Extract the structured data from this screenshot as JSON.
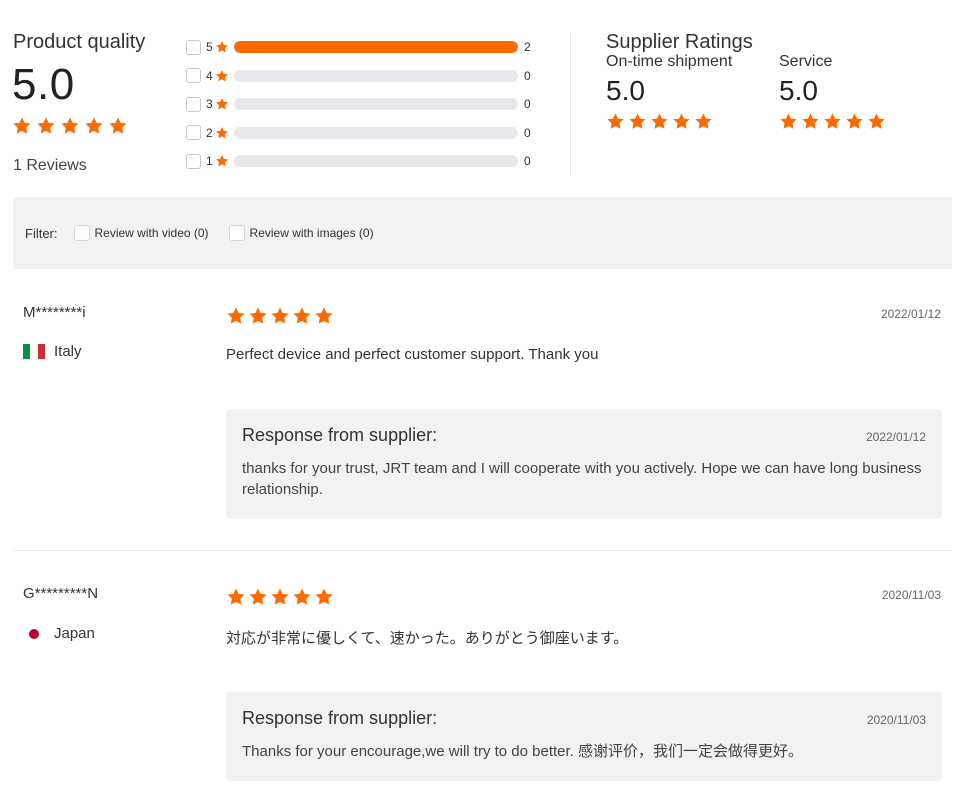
{
  "colors": {
    "accent": "#ff6a00",
    "bar_empty": "#e8e8ec",
    "panel_bg": "#f2f2f2"
  },
  "product_quality": {
    "title": "Product quality",
    "score": "5.0",
    "stars": 5,
    "reviews_label": "1 Reviews"
  },
  "distribution": [
    {
      "stars": "5",
      "count": "2",
      "fill": 1.0
    },
    {
      "stars": "4",
      "count": "0",
      "fill": 0
    },
    {
      "stars": "3",
      "count": "0",
      "fill": 0
    },
    {
      "stars": "2",
      "count": "0",
      "fill": 0
    },
    {
      "stars": "1",
      "count": "0",
      "fill": 0
    }
  ],
  "supplier_ratings": {
    "title": "Supplier Ratings",
    "on_time": {
      "label": "On-time shipment",
      "score": "5.0",
      "stars": 5
    },
    "service": {
      "label": "Service",
      "score": "5.0",
      "stars": 5
    }
  },
  "filter": {
    "label": "Filter:",
    "video": "Review with video (0)",
    "images": "Review with images (0)"
  },
  "reviews": [
    {
      "user": "M********i",
      "country": "Italy",
      "flag_icon": "italy-flag-icon",
      "stars": 5,
      "date": "2022/01/12",
      "text": "Perfect device and perfect customer support. Thank you",
      "response": {
        "title": "Response from supplier:",
        "date": "2022/01/12",
        "text": "thanks for your trust, JRT team and I will cooperate with you actively. Hope we can have long business relationship."
      }
    },
    {
      "user": "G*********N",
      "country": "Japan",
      "flag_icon": "japan-flag-icon",
      "stars": 5,
      "date": "2020/11/03",
      "text": "対応が非常に優しくて、速かった。ありがとう御座います。",
      "response": {
        "title": "Response from supplier:",
        "date": "2020/11/03",
        "text": "Thanks for your encourage,we will try to do better. 感谢评价，我们一定会做得更好。"
      }
    }
  ]
}
